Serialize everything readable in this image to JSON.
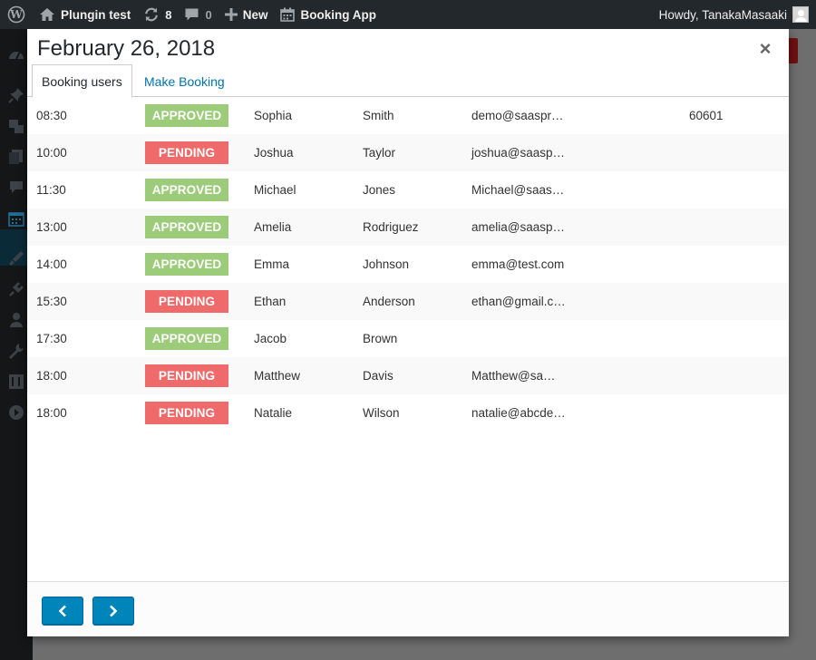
{
  "adminbar": {
    "site_name": "Plungin test",
    "updates_count": "8",
    "comments_count": "0",
    "new_label": "New",
    "app_label": "Booking App",
    "howdy": "Howdy, TanakaMasaaki"
  },
  "modal": {
    "title": "February 26, 2018",
    "close_glyph": "×",
    "tabs": [
      {
        "label": "Booking users",
        "active": true
      },
      {
        "label": "Make Booking",
        "active": false
      }
    ]
  },
  "colors": {
    "approved": "#9ccc79",
    "pending": "#ef6b6b",
    "link": "#0073aa",
    "button": "#0085ba"
  },
  "bookings": [
    {
      "time": "08:30",
      "status": "APPROVED",
      "first": "Sophia",
      "last": "Smith",
      "email": "demo@saaspr…",
      "zip": "60601"
    },
    {
      "time": "10:00",
      "status": "PENDING",
      "first": "Joshua",
      "last": "Taylor",
      "email": "joshua@saasp…",
      "zip": ""
    },
    {
      "time": "11:30",
      "status": "APPROVED",
      "first": "Michael",
      "last": "Jones",
      "email": "Michael@saas…",
      "zip": ""
    },
    {
      "time": "13:00",
      "status": "APPROVED",
      "first": "Amelia",
      "last": "Rodriguez",
      "email": "amelia@saasp…",
      "zip": ""
    },
    {
      "time": "14:00",
      "status": "APPROVED",
      "first": "Emma",
      "last": "Johnson",
      "email": "emma@test.com",
      "zip": ""
    },
    {
      "time": "15:30",
      "status": "PENDING",
      "first": "Ethan",
      "last": "Anderson",
      "email": "ethan@gmail.c…",
      "zip": ""
    },
    {
      "time": "17:30",
      "status": "APPROVED",
      "first": "Jacob",
      "last": "Brown",
      "email": "",
      "zip": ""
    },
    {
      "time": "18:00",
      "status": "PENDING",
      "first": "Matthew",
      "last": "Davis",
      "email": "Matthew@sa…",
      "zip": ""
    },
    {
      "time": "18:00",
      "status": "PENDING",
      "first": "Natalie",
      "last": "Wilson",
      "email": "natalie@abcde…",
      "zip": ""
    }
  ],
  "footer": {
    "prev_icon": "chevron-left-icon",
    "next_icon": "chevron-right-icon"
  }
}
